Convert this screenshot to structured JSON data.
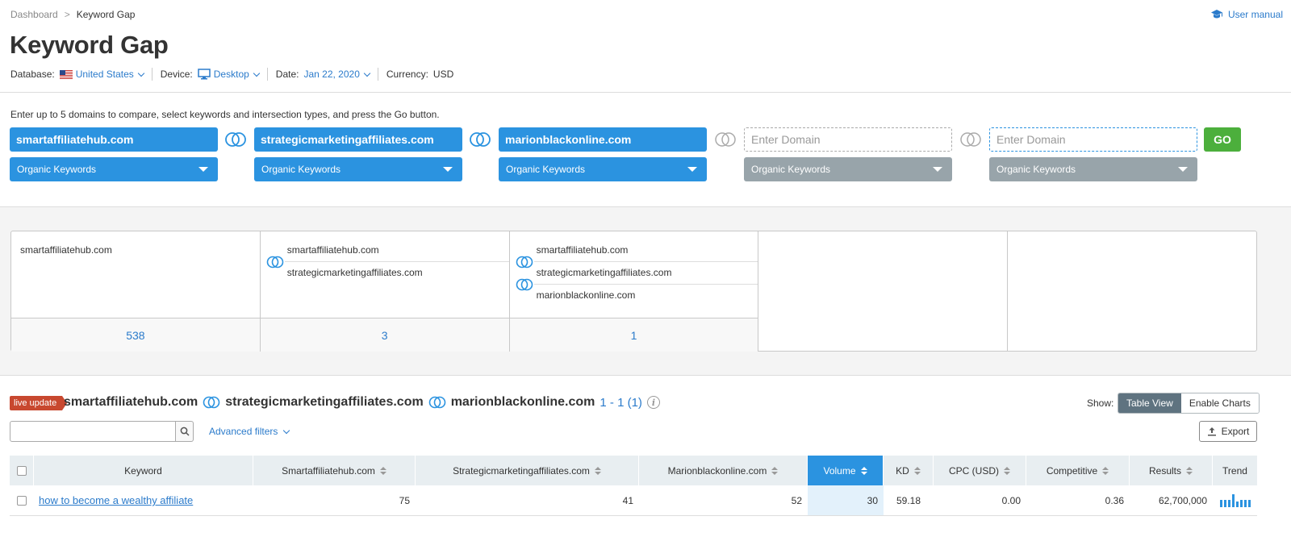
{
  "breadcrumb": {
    "home": "Dashboard",
    "separator": ">",
    "current": "Keyword Gap"
  },
  "user_manual": "User manual",
  "title": "Keyword Gap",
  "settings": {
    "database_label": "Database:",
    "database_value": "United States",
    "device_label": "Device:",
    "device_value": "Desktop",
    "date_label": "Date:",
    "date_value": "Jan 22, 2020",
    "currency_label": "Currency:",
    "currency_value": "USD"
  },
  "instructions": "Enter up to 5 domains to compare, select keywords and intersection types, and press the Go button.",
  "domains": [
    {
      "value": "smartaffiliatehub.com",
      "type": "Organic Keywords"
    },
    {
      "value": "strategicmarketingaffiliates.com",
      "type": "Organic Keywords"
    },
    {
      "value": "marionblackonline.com",
      "type": "Organic Keywords"
    },
    {
      "placeholder": "Enter Domain",
      "type": "Organic Keywords"
    },
    {
      "placeholder": "Enter Domain",
      "type": "Organic Keywords"
    }
  ],
  "go_label": "GO",
  "summary": [
    {
      "domains": [
        "smartaffiliatehub.com"
      ],
      "count": "538"
    },
    {
      "domains": [
        "smartaffiliatehub.com",
        "strategicmarketingaffiliates.com"
      ],
      "count": "3"
    },
    {
      "domains": [
        "smartaffiliatehub.com",
        "strategicmarketingaffiliates.com",
        "marionblackonline.com"
      ],
      "count": "1"
    }
  ],
  "results": {
    "live_badge": "live update",
    "domain1": "smartaffiliatehub.com",
    "domain2": "strategicmarketingaffiliates.com",
    "domain3": "marionblackonline.com",
    "count": "1 - 1 (1)",
    "info": "i",
    "show_label": "Show:",
    "view_table": "Table View",
    "view_charts": "Enable Charts",
    "advanced_filters": "Advanced filters",
    "export": "Export"
  },
  "table": {
    "headers": [
      "Keyword",
      "Smartaffiliatehub.com",
      "Strategicmarketingaffiliates.com",
      "Marionblackonline.com",
      "Volume",
      "KD",
      "CPC (USD)",
      "Competitive",
      "Results",
      "Trend"
    ],
    "rows": [
      {
        "keyword": "how to become a wealthy affiliate",
        "d1": "75",
        "d2": "41",
        "d3": "52",
        "volume": "30",
        "kd": "59.18",
        "cpc": "0.00",
        "competitive": "0.36",
        "results": "62,700,000",
        "trend": [
          0.55,
          0.55,
          0.55,
          1.0,
          0.45,
          0.55,
          0.55,
          0.55
        ]
      }
    ]
  },
  "colors": {
    "accent": "#2b93e0",
    "go": "#4caf3c",
    "live": "#c8482f",
    "disabled": "#98a4aa"
  }
}
